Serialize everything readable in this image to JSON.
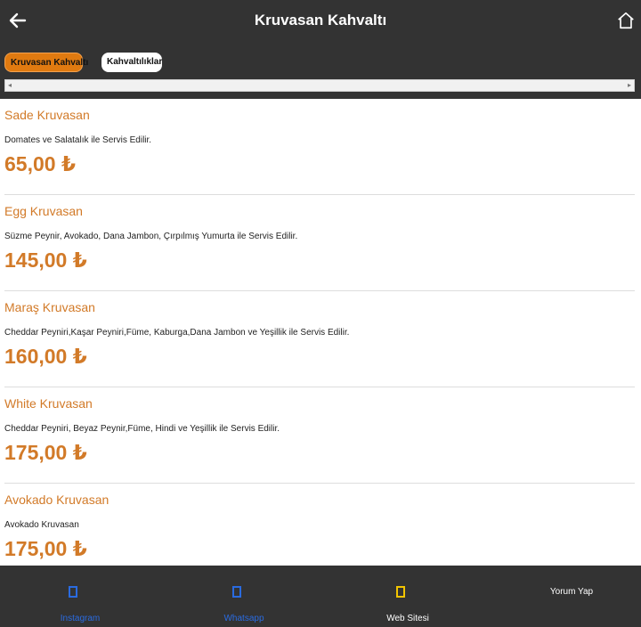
{
  "header": {
    "title": "Kruvasan Kahvaltı",
    "back_icon": "back-arrow-icon",
    "home_icon": "home-icon"
  },
  "tabs": [
    {
      "label": "Kruvasan Kahvaltı",
      "active": true
    },
    {
      "label": "Kahvaltılıklar",
      "active": false
    }
  ],
  "items": [
    {
      "name": "Sade Kruvasan",
      "description": "Domates ve Salatalık ile Servis Edilir.",
      "price": "65,00 ₺"
    },
    {
      "name": "Egg Kruvasan",
      "description": "Süzme Peynir, Avokado, Dana Jambon, Çırpılmış Yumurta ile Servis Edilir.",
      "price": "145,00 ₺"
    },
    {
      "name": "Maraş Kruvasan",
      "description": "Cheddar Peyniri,Kaşar Peyniri,Füme, Kaburga,Dana Jambon ve Yeşillik ile Servis Edilir.",
      "price": "160,00 ₺"
    },
    {
      "name": "White Kruvasan",
      "description": "Cheddar Peyniri, Beyaz Peynir,Füme, Hindi ve Yeşillik ile Servis Edilir.",
      "price": "175,00 ₺"
    },
    {
      "name": "Avokado Kruvasan",
      "description": "Avokado Kruvasan",
      "price": "175,00 ₺"
    }
  ],
  "bottom_nav": {
    "instagram": {
      "label": "Instagram",
      "color": "#2a6be0"
    },
    "whatsapp": {
      "label": "Whatsapp",
      "color": "#2a6be0"
    },
    "website": {
      "label": "Web Sitesi",
      "color": "#f2c400"
    },
    "review": {
      "label": "Yorum Yap"
    }
  },
  "colors": {
    "accent": "#d27a28",
    "bar": "#333333",
    "active_tab": "#e07a10"
  }
}
